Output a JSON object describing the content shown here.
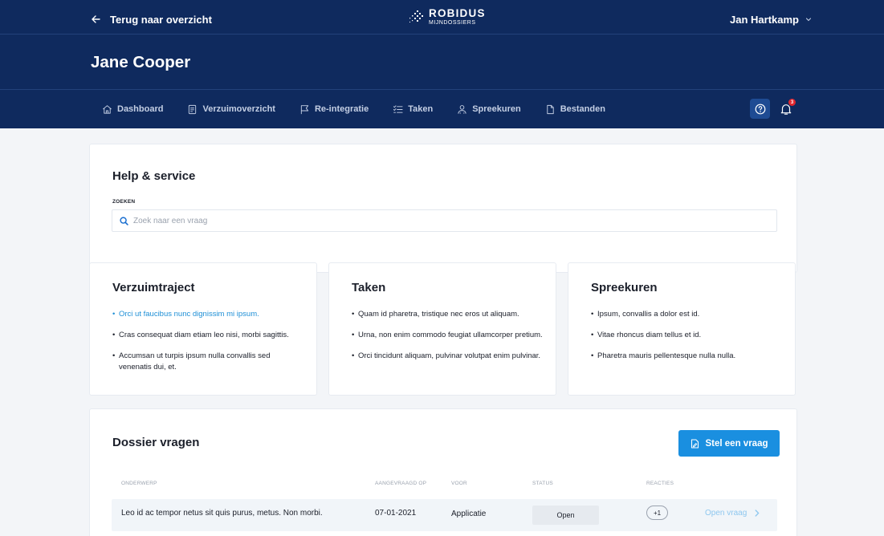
{
  "header": {
    "back_label": "Terug naar overzicht",
    "logo": {
      "name": "ROBIDUS",
      "sub": "MIJNDOSSIERS"
    },
    "user_name": "Jan Hartkamp",
    "person_name": "Jane Cooper",
    "notification_count": "3"
  },
  "nav": {
    "items": [
      {
        "label": "Dashboard",
        "icon": "home-icon"
      },
      {
        "label": "Verzuimoverzicht",
        "icon": "document-icon"
      },
      {
        "label": "Re-integratie",
        "icon": "flag-icon"
      },
      {
        "label": "Taken",
        "icon": "checklist-icon"
      },
      {
        "label": "Spreekuren",
        "icon": "users-icon"
      },
      {
        "label": "Bestanden",
        "icon": "file-icon"
      }
    ]
  },
  "help": {
    "title": "Help & service",
    "search_label": "ZOEKEN",
    "search_placeholder": "Zoek naar een vraag",
    "search_value": ""
  },
  "cards": [
    {
      "title": "Verzuimtraject",
      "items": [
        "Orci ut faucibus nunc dignissim mi ipsum.",
        "Cras consequat diam etiam leo nisi, morbi sagittis.",
        "Accumsan ut turpis ipsum nulla convallis sed venenatis dui, et."
      ]
    },
    {
      "title": "Taken",
      "items": [
        "Quam id pharetra, tristique nec eros ut aliquam.",
        "Urna, non enim commodo feugiat ullamcorper pretium.",
        "Orci tincidunt aliquam, pulvinar volutpat enim pulvinar."
      ]
    },
    {
      "title": "Spreekuren",
      "items": [
        "Ipsum, convallis a dolor est id.",
        "Vitae rhoncus diam tellus et id.",
        "Pharetra mauris pellentesque nulla nulla."
      ]
    }
  ],
  "dossier": {
    "title": "Dossier vragen",
    "ask_button": "Stel een vraag",
    "columns": {
      "subject": "ONDERWERP",
      "requested": "AANGEVRAAGD OP",
      "for": "VOOR",
      "status": "STATUS",
      "replies": "REACTIES"
    },
    "rows": [
      {
        "subject": "Leo id ac tempor netus sit quis purus, metus. Non morbi.",
        "requested": "07-01-2021",
        "for": "Applicatie",
        "status": "Open",
        "replies": "+1",
        "action": "Open vraag"
      }
    ]
  },
  "colors": {
    "header_bg": "#0f2a5e",
    "primary_button": "#1a8fe0",
    "link": "#1e8fd6",
    "badge_red": "#e0272f"
  }
}
